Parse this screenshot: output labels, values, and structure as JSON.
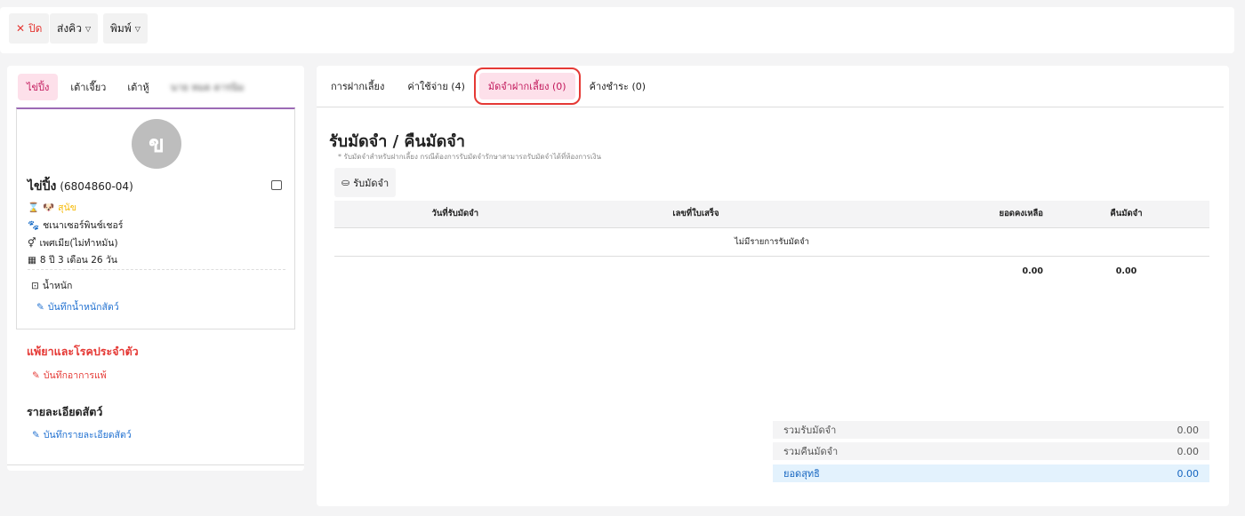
{
  "toolbar": {
    "close": "ปิด",
    "queue": "ส่งคิว",
    "print": "พิมพ์"
  },
  "pet_tabs": [
    "ไข่ปิ้ง",
    "เต้าเจี๊ยว",
    "เต้าหู้",
    "นาย หมด ดารนิม"
  ],
  "pet": {
    "avatar_letter": "ข",
    "name": "ไข่ปิ้ง",
    "code": "(6804860-04)",
    "species": "สุนัข",
    "breed": "ชเนาเซอร์พินช์เชอร์",
    "sex": "เพศเมีย(ไม่ทำหมัน)",
    "age": "8 ปี 3 เดือน 26 วัน",
    "weight_label": "น้ำหนัก",
    "weight_link": "บันทึกน้ำหนักสัตว์"
  },
  "allergy": {
    "title": "แพ้ยาและโรคประจำตัว",
    "link": "บันทึกอาการแพ้"
  },
  "details": {
    "title": "รายละเอียดสัตว์",
    "link": "บันทึกรายละเอียดสัตว์"
  },
  "main_tabs": [
    "การฝากเลี้ยง",
    "ค่าใช้จ่าย (4)",
    "มัดจำฝากเลี้ยง (0)",
    "ค้างชำระ (0)"
  ],
  "deposit": {
    "title": "รับมัดจำ / คืนมัดจำ",
    "note": "* รับมัดจำสำหรับฝากเลี้ยง กรณีต้องการรับมัดจำรักษาสามารถรับมัดจำได้ที่ห้องการเงิน",
    "button": "รับมัดจำ",
    "columns": [
      "วันที่รับมัดจำ",
      "เลขที่ใบเสร็จ",
      "ยอดคงเหลือ",
      "คืนมัดจำ"
    ],
    "empty": "ไม่มีรายการรับมัดจำ",
    "total_balance": "0.00",
    "total_refund": "0.00"
  },
  "summary": [
    {
      "label": "รวมรับมัดจำ",
      "value": "0.00"
    },
    {
      "label": "รวมคืนมัดจำ",
      "value": "0.00"
    },
    {
      "label": "ยอดสุทธิ",
      "value": "0.00"
    }
  ]
}
